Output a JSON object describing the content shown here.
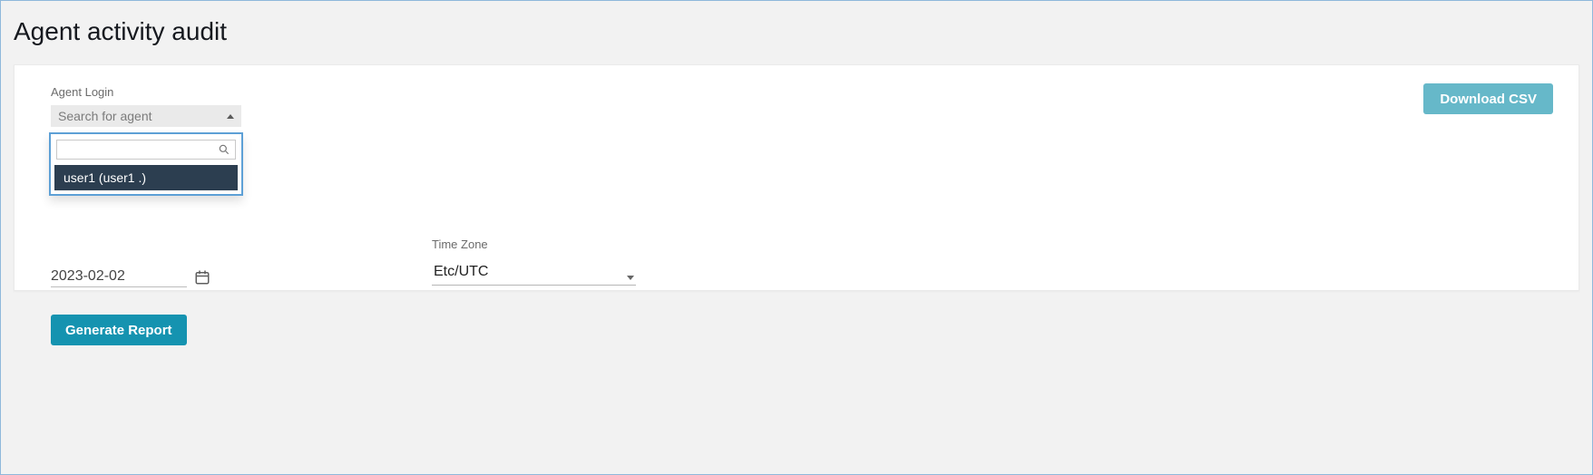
{
  "page": {
    "title": "Agent activity audit"
  },
  "agent_search": {
    "label": "Agent Login",
    "placeholder": "Search for agent",
    "input_value": "",
    "options": [
      "user1 (user1 .)"
    ]
  },
  "date": {
    "value": "2023-02-02"
  },
  "timezone": {
    "label": "Time Zone",
    "value": "Etc/UTC"
  },
  "buttons": {
    "download_csv": "Download CSV",
    "generate_report": "Generate Report"
  }
}
